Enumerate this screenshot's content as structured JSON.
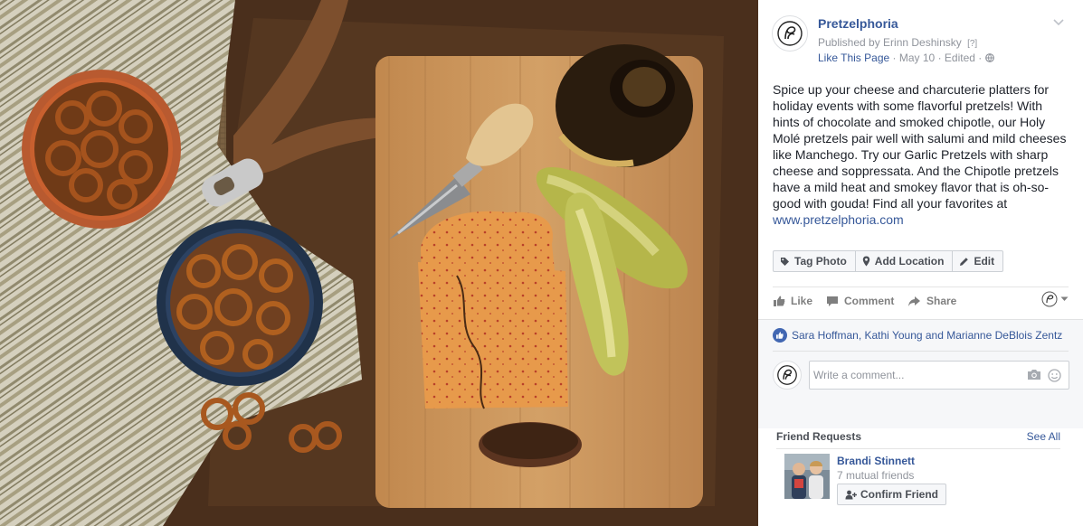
{
  "photo": {
    "alt_icon": "food-photo",
    "colors": {
      "burlap": "#7a6142",
      "board": "#c8965c",
      "cheese": "#e59646",
      "pretzel": "#a8581f"
    }
  },
  "post": {
    "page_name": "Pretzelphoria",
    "published_by": "Published by Erinn Deshinsky",
    "help_marker": "[?]",
    "like_page": "Like This Page",
    "date": "May 10",
    "edited": "Edited",
    "privacy_icon": "globe-icon",
    "text_lines": [
      "Spice up your cheese and charcuterie platters for",
      "holiday events with some flavorful pretzels! With",
      "hints of chocolate and smoked chipotle, our Holy",
      "Molé pretzels pair well with salumi and mild cheeses",
      "like Manchego. Try our Garlic Pretzels with sharp",
      "cheese and soppressata. And the Chipotle pretzels",
      "have a mild heat and smokey flavor that is oh-so-",
      "good with gouda! Find all your favorites at"
    ],
    "link": "www.pretzelphoria.com"
  },
  "tag_bar": {
    "tag_photo": "Tag Photo",
    "add_location": "Add Location",
    "edit": "Edit"
  },
  "actions": {
    "like": "Like",
    "comment": "Comment",
    "share": "Share"
  },
  "feedback": {
    "likers": "Sara Hoffman, Kathi Young and Marianne DeBlois Zentz",
    "comment_placeholder": "Write a comment..."
  },
  "friend_requests": {
    "title": "Friend Requests",
    "see_all": "See All",
    "name": "Brandi Stinnett",
    "mutual": "7 mutual friends",
    "confirm": "Confirm Friend"
  },
  "colors": {
    "link": "#365899",
    "muted": "#90949c",
    "text": "#1d2129",
    "like_blue": "#4267b2"
  }
}
